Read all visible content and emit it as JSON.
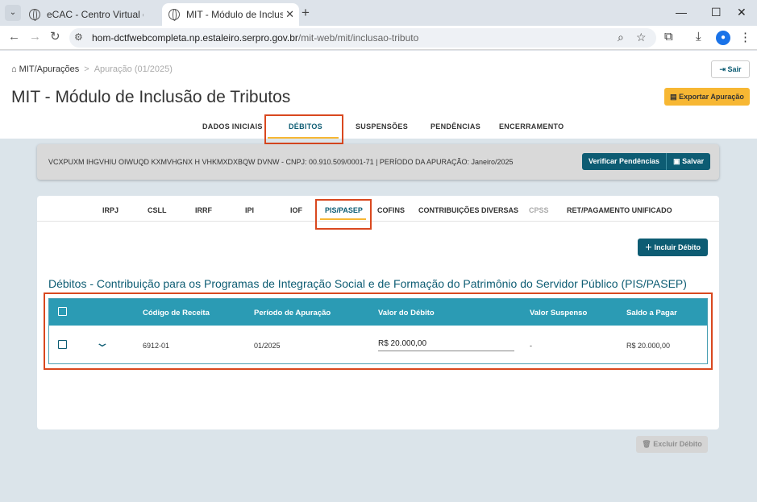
{
  "browser": {
    "tabs": [
      {
        "title": "eCAC - Centro Virtual de Atendimento"
      },
      {
        "title": "MIT - Módulo de Inclusão de Tributos"
      }
    ],
    "url_host": "hom-dctfwebcompleta.np.estaleiro.serpro.gov.br",
    "url_path": "/mit-web/mit/inclusao-tributo"
  },
  "breadcrumb": {
    "home": "MIT/Apurações",
    "current": "Apuração (01/2025)"
  },
  "header": {
    "title": "MIT - Módulo de Inclusão de Tributos",
    "sair_label": "Sair",
    "export_label": "Exportar Apuração"
  },
  "main_tabs": [
    "DADOS INICIAIS",
    "DÉBITOS",
    "SUSPENSÕES",
    "PENDÊNCIAS",
    "ENCERRAMENTO"
  ],
  "info": {
    "text": "VCXPUXM IHGVHIU OIWUQD KXMVHGNX H VHKMXDXBQW DVNW - CNPJ: 00.910.509/0001-71  |  PERÍODO DA APURAÇÃO: Janeiro/2025",
    "verify_label": "Verificar Pendências",
    "save_label": "Salvar"
  },
  "sub_tabs": [
    "IRPJ",
    "CSLL",
    "IRRF",
    "IPI",
    "IOF",
    "PIS/PASEP",
    "COFINS",
    "CONTRIBUIÇÕES DIVERSAS",
    "CPSS",
    "RET/PAGAMENTO UNIFICADO"
  ],
  "include_label": "Incluir Débito",
  "section_title": "Débitos - Contribuição para os Programas de Integração Social e de Formação do Patrimônio do Servidor Público (PIS/PASEP)",
  "table": {
    "headers": [
      "Código de Receita",
      "Período de Apuração",
      "Valor do Débito",
      "Valor Suspenso",
      "Saldo a Pagar"
    ],
    "rows": [
      {
        "codigo": "6912-01",
        "periodo": "01/2025",
        "valor": "R$  20.000,00",
        "suspenso": "-",
        "saldo": "R$ 20.000,00"
      }
    ]
  },
  "delete_label": "Excluir Débito",
  "colors": {
    "primary": "#0d5c73",
    "accent": "#f7b733",
    "table_header": "#2b9bb4",
    "highlight": "#d9481f"
  }
}
